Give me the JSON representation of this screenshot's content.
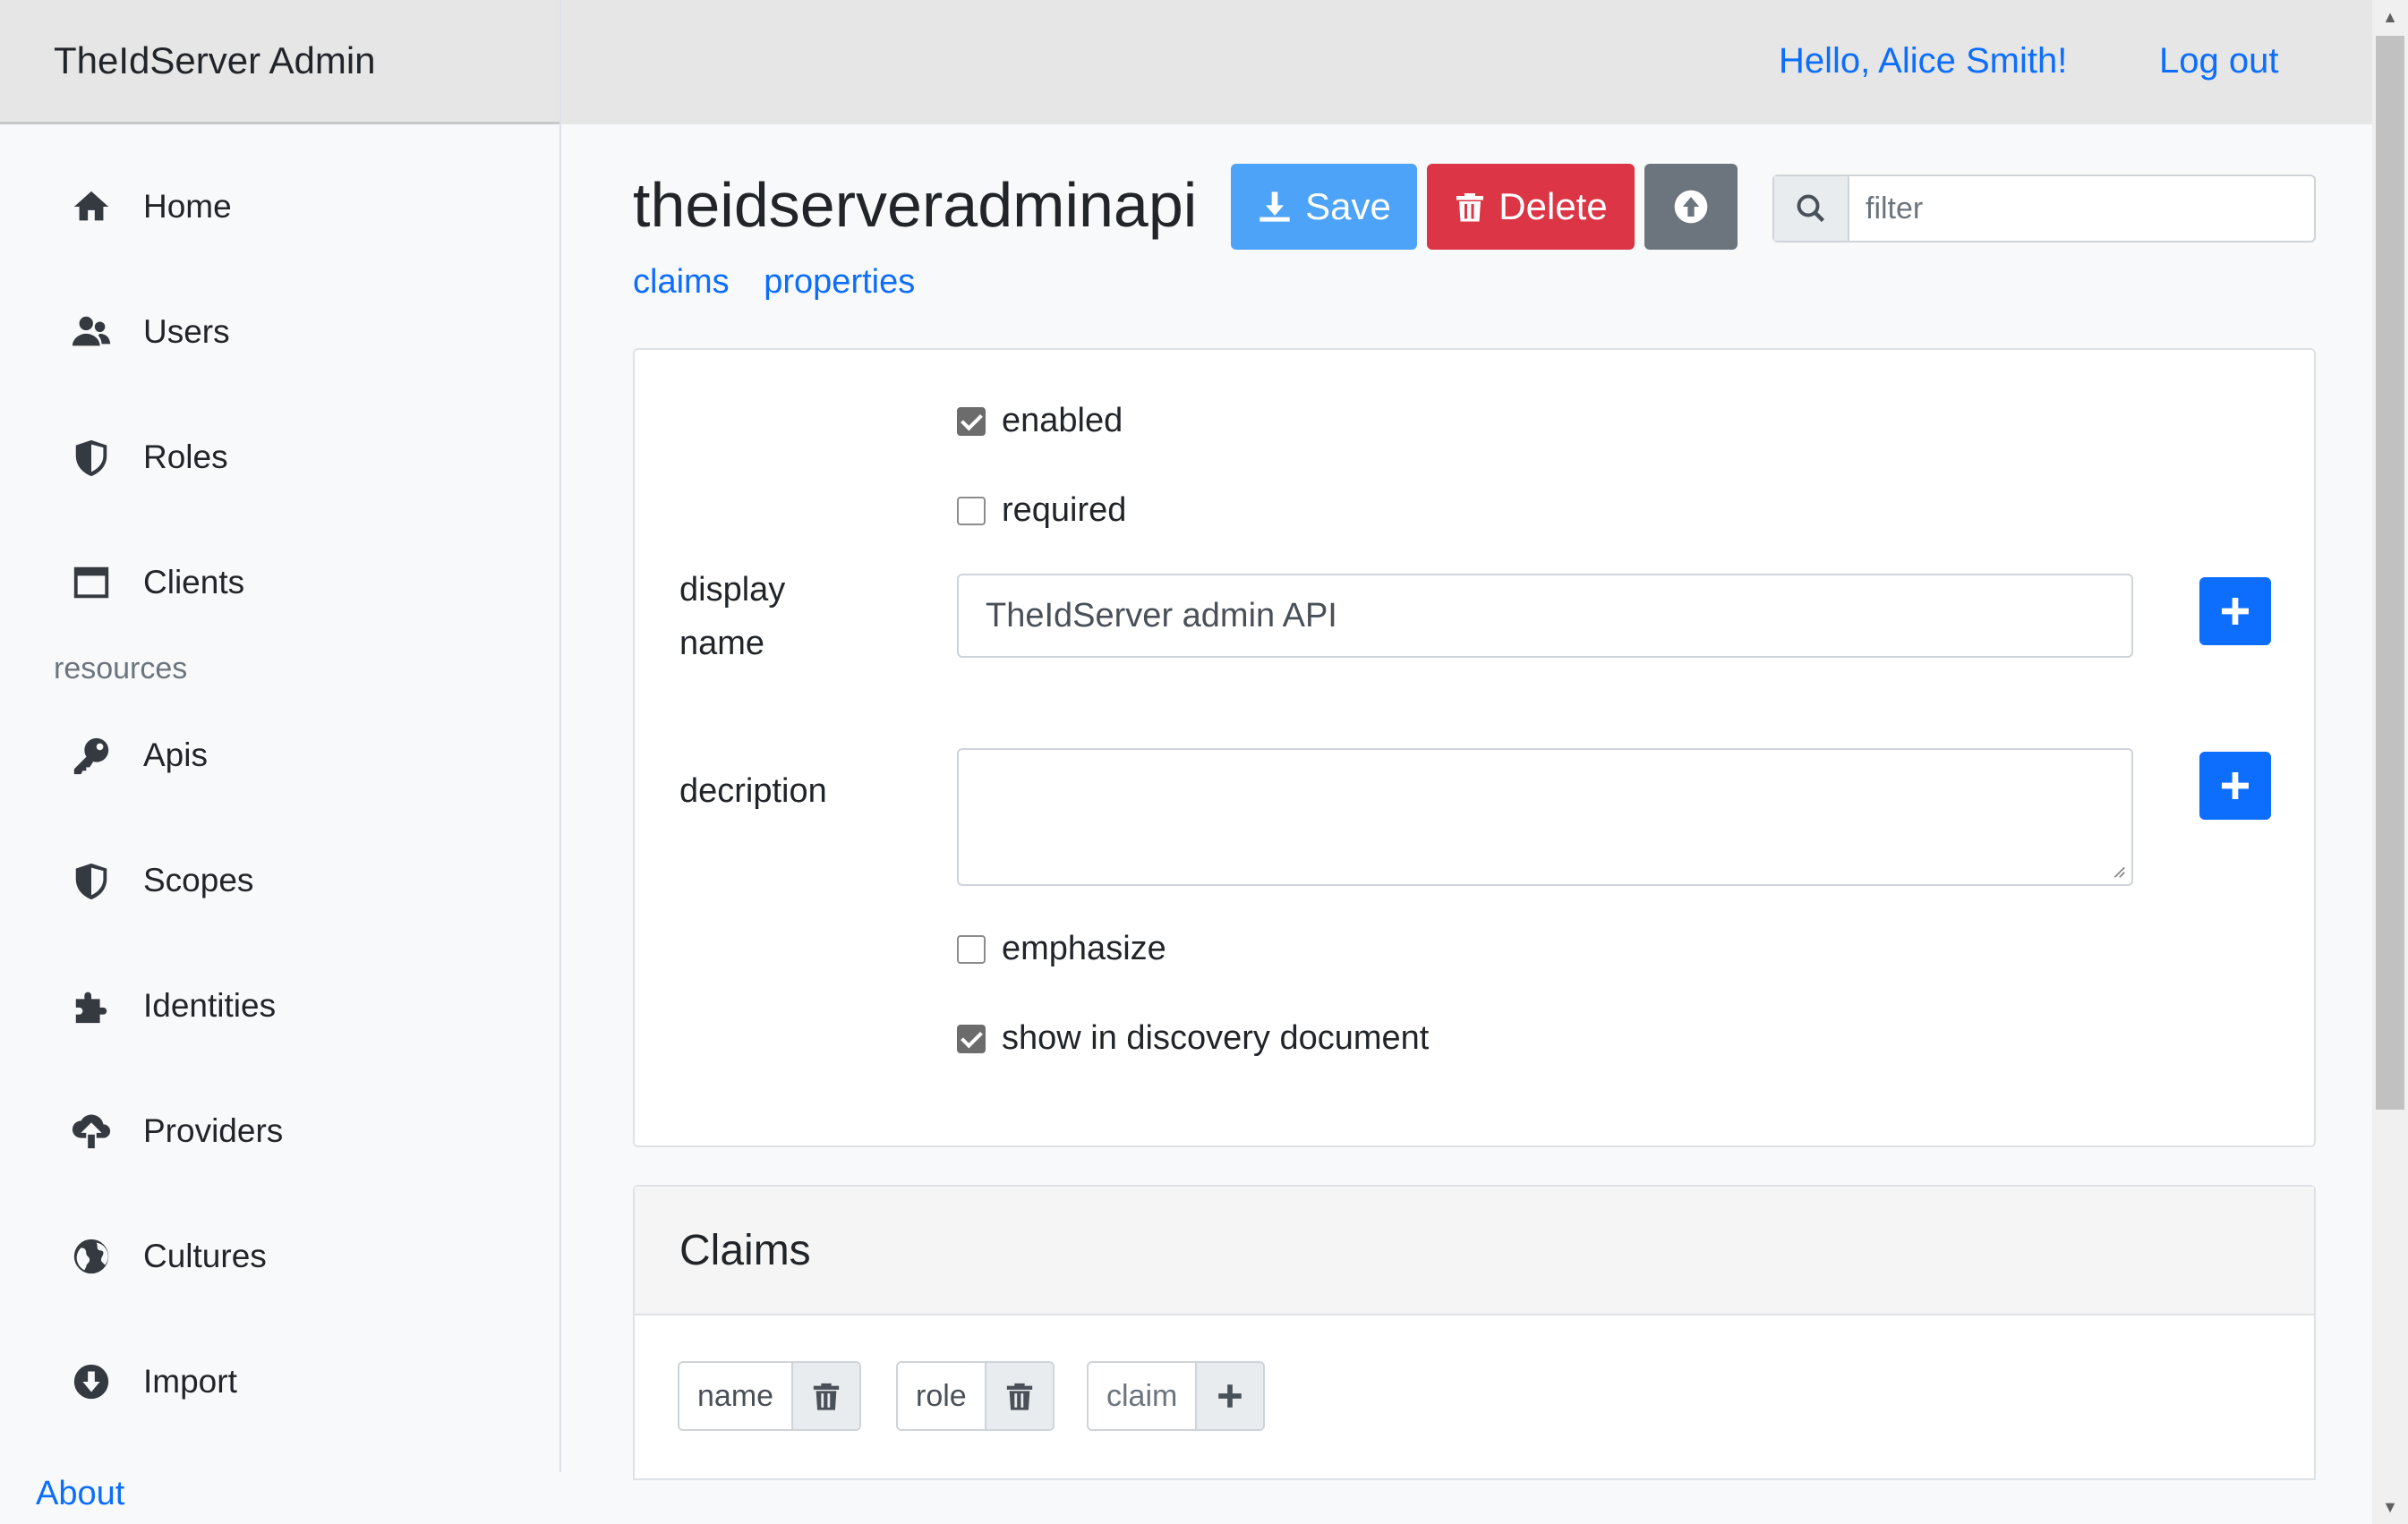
{
  "app": {
    "brand": "TheIdServer Admin"
  },
  "topbar": {
    "greeting": "Hello, Alice Smith!",
    "logout": "Log out"
  },
  "sidebar": {
    "items": [
      {
        "label": "Home",
        "icon": "home-icon"
      },
      {
        "label": "Users",
        "icon": "users-icon"
      },
      {
        "label": "Roles",
        "icon": "shield-icon"
      },
      {
        "label": "Clients",
        "icon": "window-icon"
      }
    ],
    "section_label": "resources",
    "resource_items": [
      {
        "label": "Apis",
        "icon": "key-icon"
      },
      {
        "label": "Scopes",
        "icon": "shield-icon"
      },
      {
        "label": "Identities",
        "icon": "puzzle-icon"
      },
      {
        "label": "Providers",
        "icon": "cloud-upload-icon"
      },
      {
        "label": "Cultures",
        "icon": "globe-icon"
      },
      {
        "label": "Import",
        "icon": "arrow-circle-down-icon"
      }
    ],
    "about": "About"
  },
  "page": {
    "title": "theidserveradminapi",
    "save_label": "Save",
    "delete_label": "Delete",
    "filter_placeholder": "filter",
    "links": [
      "claims",
      "properties"
    ]
  },
  "form": {
    "enabled": {
      "label": "enabled",
      "checked": true
    },
    "required": {
      "label": "required",
      "checked": false
    },
    "display_name": {
      "label": "display name",
      "value": "TheIdServer admin API"
    },
    "description": {
      "label": "decription",
      "value": ""
    },
    "emphasize": {
      "label": "emphasize",
      "checked": false
    },
    "show_in_discovery": {
      "label": "show in discovery document",
      "checked": true
    }
  },
  "claims": {
    "title": "Claims",
    "tags": [
      "name",
      "role"
    ],
    "new_placeholder": "claim"
  },
  "colors": {
    "primary": "#0d6efd",
    "save": "#4ca3f7",
    "danger": "#dc3545",
    "secondary": "#6c757d"
  }
}
